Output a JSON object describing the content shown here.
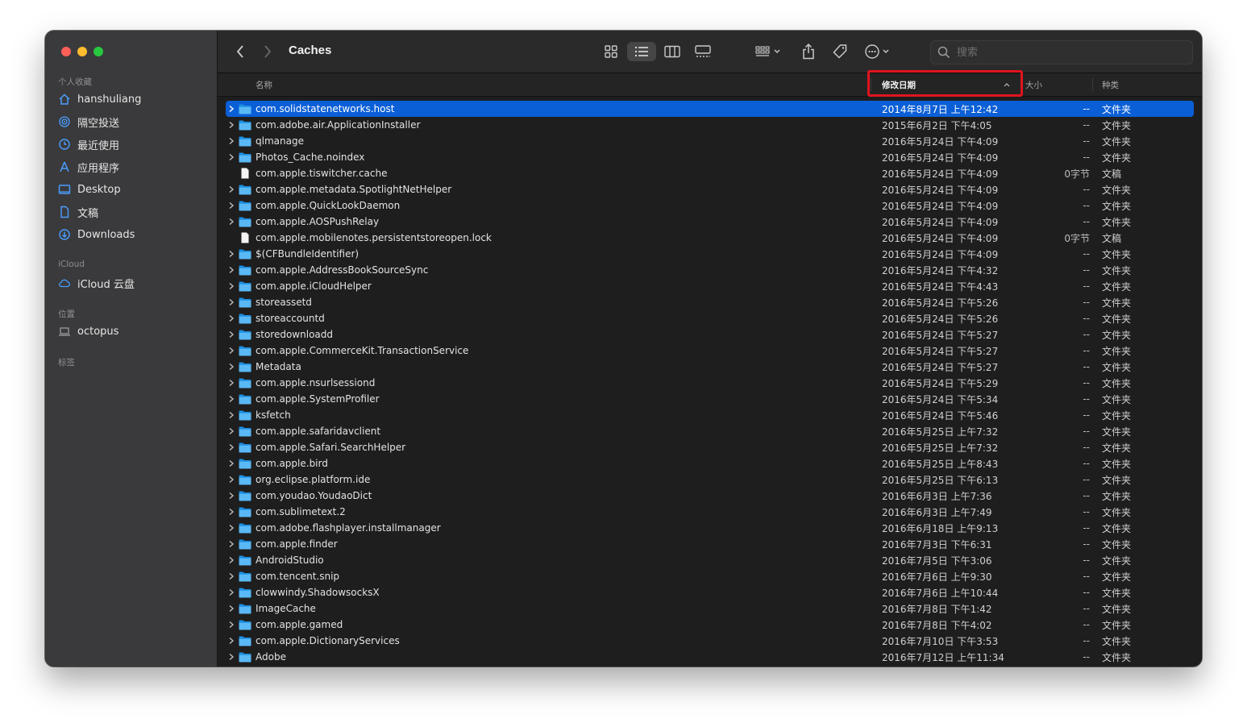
{
  "window": {
    "title": "Caches",
    "traffic_colors": {
      "close": "#ff5f57",
      "minimize": "#febc2e",
      "zoom": "#28c840"
    },
    "accent": "#0b5fd6",
    "highlight_box_color": "#e0141e"
  },
  "sidebar": {
    "favorites_label": "个人收藏",
    "favorites": [
      {
        "label": "hanshuliang",
        "icon": "home-icon"
      },
      {
        "label": "隔空投送",
        "icon": "airdrop-icon"
      },
      {
        "label": "最近使用",
        "icon": "clock-icon"
      },
      {
        "label": "应用程序",
        "icon": "applications-icon"
      },
      {
        "label": "Desktop",
        "icon": "desktop-icon"
      },
      {
        "label": "文稿",
        "icon": "document-icon"
      },
      {
        "label": "Downloads",
        "icon": "download-icon"
      }
    ],
    "icloud_label": "iCloud",
    "icloud": [
      {
        "label": "iCloud 云盘",
        "icon": "cloud-icon"
      }
    ],
    "locations_label": "位置",
    "locations": [
      {
        "label": "octopus",
        "icon": "laptop-icon"
      }
    ],
    "tags_label": "标签"
  },
  "toolbar": {
    "back_icon": "chevron-left-icon",
    "forward_icon": "chevron-right-icon",
    "view_icons": [
      "grid-view-icon",
      "list-view-icon",
      "column-view-icon",
      "gallery-view-icon"
    ],
    "group_icon": "group-icon",
    "share_icon": "share-icon",
    "tag_icon": "tag-icon",
    "more_icon": "ellipsis-circle-icon",
    "search_placeholder": "搜索"
  },
  "columns": {
    "name": "名称",
    "date": "修改日期",
    "size": "大小",
    "kind": "种类"
  },
  "files": [
    {
      "name": "com.solidstatenetworks.host",
      "date": "2014年8月7日 上午12:42",
      "size": "--",
      "kind": "文件夹",
      "type": "folder",
      "selected": true
    },
    {
      "name": "com.adobe.air.ApplicationInstaller",
      "date": "2015年6月2日 下午4:05",
      "size": "--",
      "kind": "文件夹",
      "type": "folder"
    },
    {
      "name": "qlmanage",
      "date": "2016年5月24日 下午4:09",
      "size": "--",
      "kind": "文件夹",
      "type": "folder"
    },
    {
      "name": "Photos_Cache.noindex",
      "date": "2016年5月24日 下午4:09",
      "size": "--",
      "kind": "文件夹",
      "type": "folder"
    },
    {
      "name": "com.apple.tiswitcher.cache",
      "date": "2016年5月24日 下午4:09",
      "size": "0字节",
      "kind": "文稿",
      "type": "file"
    },
    {
      "name": "com.apple.metadata.SpotlightNetHelper",
      "date": "2016年5月24日 下午4:09",
      "size": "--",
      "kind": "文件夹",
      "type": "folder"
    },
    {
      "name": "com.apple.QuickLookDaemon",
      "date": "2016年5月24日 下午4:09",
      "size": "--",
      "kind": "文件夹",
      "type": "folder"
    },
    {
      "name": "com.apple.AOSPushRelay",
      "date": "2016年5月24日 下午4:09",
      "size": "--",
      "kind": "文件夹",
      "type": "folder"
    },
    {
      "name": "com.apple.mobilenotes.persistentstoreopen.lock",
      "date": "2016年5月24日 下午4:09",
      "size": "0字节",
      "kind": "文稿",
      "type": "file"
    },
    {
      "name": "$(CFBundleIdentifier)",
      "date": "2016年5月24日 下午4:09",
      "size": "--",
      "kind": "文件夹",
      "type": "folder"
    },
    {
      "name": "com.apple.AddressBookSourceSync",
      "date": "2016年5月24日 下午4:32",
      "size": "--",
      "kind": "文件夹",
      "type": "folder"
    },
    {
      "name": "com.apple.iCloudHelper",
      "date": "2016年5月24日 下午4:43",
      "size": "--",
      "kind": "文件夹",
      "type": "folder"
    },
    {
      "name": "storeassetd",
      "date": "2016年5月24日 下午5:26",
      "size": "--",
      "kind": "文件夹",
      "type": "folder"
    },
    {
      "name": "storeaccountd",
      "date": "2016年5月24日 下午5:26",
      "size": "--",
      "kind": "文件夹",
      "type": "folder"
    },
    {
      "name": "storedownloadd",
      "date": "2016年5月24日 下午5:27",
      "size": "--",
      "kind": "文件夹",
      "type": "folder"
    },
    {
      "name": "com.apple.CommerceKit.TransactionService",
      "date": "2016年5月24日 下午5:27",
      "size": "--",
      "kind": "文件夹",
      "type": "folder"
    },
    {
      "name": "Metadata",
      "date": "2016年5月24日 下午5:27",
      "size": "--",
      "kind": "文件夹",
      "type": "folder"
    },
    {
      "name": "com.apple.nsurlsessiond",
      "date": "2016年5月24日 下午5:29",
      "size": "--",
      "kind": "文件夹",
      "type": "folder"
    },
    {
      "name": "com.apple.SystemProfiler",
      "date": "2016年5月24日 下午5:34",
      "size": "--",
      "kind": "文件夹",
      "type": "folder"
    },
    {
      "name": "ksfetch",
      "date": "2016年5月24日 下午5:46",
      "size": "--",
      "kind": "文件夹",
      "type": "folder"
    },
    {
      "name": "com.apple.safaridavclient",
      "date": "2016年5月25日 上午7:32",
      "size": "--",
      "kind": "文件夹",
      "type": "folder"
    },
    {
      "name": "com.apple.Safari.SearchHelper",
      "date": "2016年5月25日 上午7:32",
      "size": "--",
      "kind": "文件夹",
      "type": "folder"
    },
    {
      "name": "com.apple.bird",
      "date": "2016年5月25日 上午8:43",
      "size": "--",
      "kind": "文件夹",
      "type": "folder"
    },
    {
      "name": "org.eclipse.platform.ide",
      "date": "2016年5月25日 下午6:13",
      "size": "--",
      "kind": "文件夹",
      "type": "folder"
    },
    {
      "name": "com.youdao.YoudaoDict",
      "date": "2016年6月3日 上午7:36",
      "size": "--",
      "kind": "文件夹",
      "type": "folder"
    },
    {
      "name": "com.sublimetext.2",
      "date": "2016年6月3日 上午7:49",
      "size": "--",
      "kind": "文件夹",
      "type": "folder"
    },
    {
      "name": "com.adobe.flashplayer.installmanager",
      "date": "2016年6月18日 上午9:13",
      "size": "--",
      "kind": "文件夹",
      "type": "folder"
    },
    {
      "name": "com.apple.finder",
      "date": "2016年7月3日 下午6:31",
      "size": "--",
      "kind": "文件夹",
      "type": "folder"
    },
    {
      "name": "AndroidStudio",
      "date": "2016年7月5日 下午3:06",
      "size": "--",
      "kind": "文件夹",
      "type": "folder"
    },
    {
      "name": "com.tencent.snip",
      "date": "2016年7月6日 上午9:30",
      "size": "--",
      "kind": "文件夹",
      "type": "folder"
    },
    {
      "name": "clowwindy.ShadowsocksX",
      "date": "2016年7月6日 上午10:44",
      "size": "--",
      "kind": "文件夹",
      "type": "folder"
    },
    {
      "name": "ImageCache",
      "date": "2016年7月8日 下午1:42",
      "size": "--",
      "kind": "文件夹",
      "type": "folder"
    },
    {
      "name": "com.apple.gamed",
      "date": "2016年7月8日 下午4:02",
      "size": "--",
      "kind": "文件夹",
      "type": "folder"
    },
    {
      "name": "com.apple.DictionaryServices",
      "date": "2016年7月10日 下午3:53",
      "size": "--",
      "kind": "文件夹",
      "type": "folder"
    },
    {
      "name": "Adobe",
      "date": "2016年7月12日 上午11:34",
      "size": "--",
      "kind": "文件夹",
      "type": "folder"
    }
  ]
}
